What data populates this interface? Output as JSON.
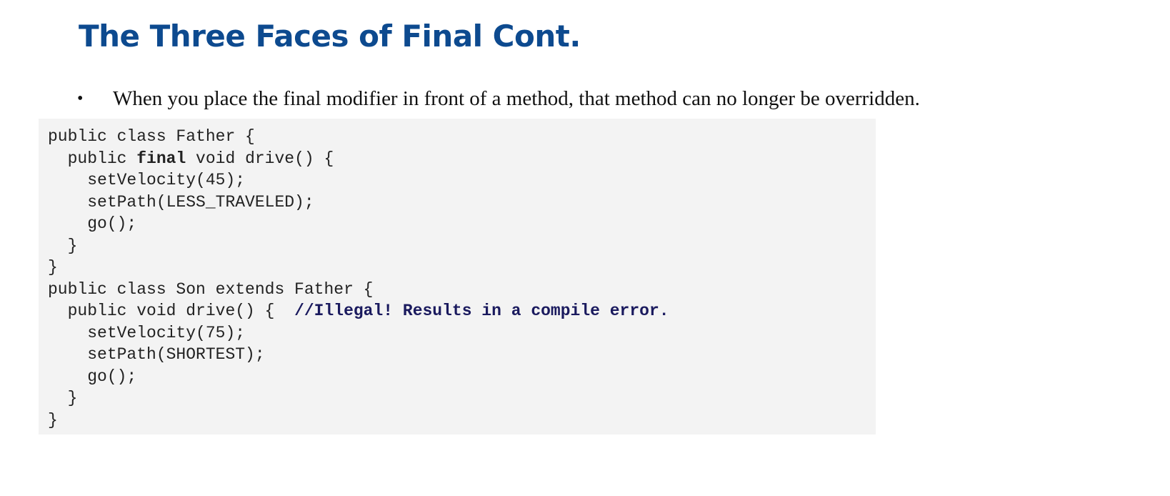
{
  "slide": {
    "title": "The Three Faces of Final Cont.",
    "bullet": {
      "marker": "•",
      "text": "When you place the final modifier in front of a method, that method can no longer be overridden."
    }
  },
  "code": {
    "lines": [
      {
        "text": "public class Father {"
      },
      {
        "indent": "  ",
        "before": "public ",
        "bold": "final",
        "after": " void drive() {"
      },
      {
        "text": "    setVelocity(45);"
      },
      {
        "text": "    setPath(LESS_TRAVELED);"
      },
      {
        "text": "    go();"
      },
      {
        "text": "  }"
      },
      {
        "text": "}"
      },
      {
        "text": "public class Son extends Father {"
      },
      {
        "text": "  public void drive() {  ",
        "comment": "//Illegal! Results in a compile error."
      },
      {
        "text": "    setVelocity(75);"
      },
      {
        "text": "    setPath(SHORTEST);"
      },
      {
        "text": "    go();"
      },
      {
        "text": "  }"
      },
      {
        "text": "}"
      }
    ]
  }
}
